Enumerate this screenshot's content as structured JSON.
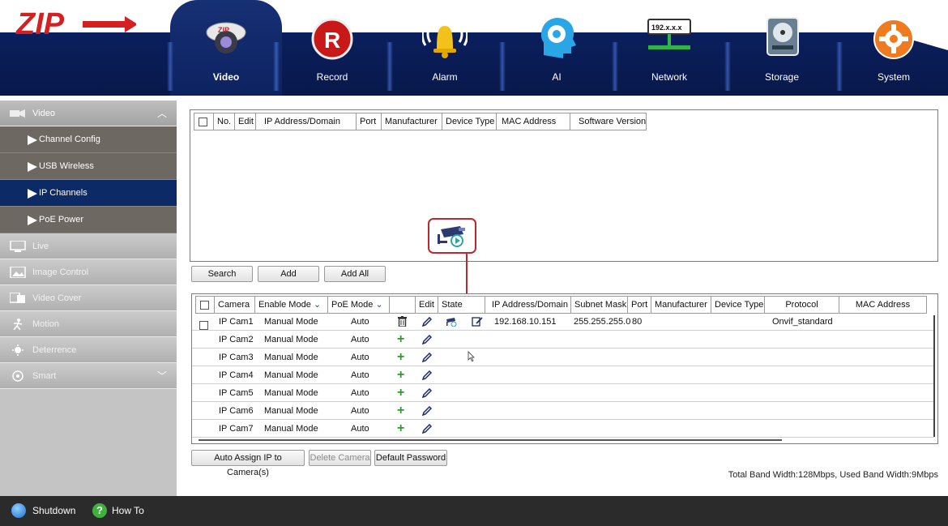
{
  "nav": {
    "items": [
      {
        "label": "Video",
        "icon": "dome-camera-icon",
        "active": true
      },
      {
        "label": "Record",
        "icon": "record-icon"
      },
      {
        "label": "Alarm",
        "icon": "alarm-bell-icon"
      },
      {
        "label": "AI",
        "icon": "ai-head-gear-icon"
      },
      {
        "label": "Network",
        "icon": "network-icon",
        "icon_text": "192.x.x.x"
      },
      {
        "label": "Storage",
        "icon": "hard-disk-icon"
      },
      {
        "label": "System",
        "icon": "system-gear-icon"
      }
    ]
  },
  "logo": {
    "text": "ZIP"
  },
  "sidebar": {
    "video": {
      "label": "Video"
    },
    "subitems": [
      {
        "label": "Channel Config"
      },
      {
        "label": "USB Wireless"
      },
      {
        "label": "IP Channels",
        "active": true
      },
      {
        "label": "PoE Power"
      }
    ],
    "groups": [
      {
        "label": "Live",
        "icon": "monitor-icon"
      },
      {
        "label": "Image Control",
        "icon": "image-icon"
      },
      {
        "label": "Video Cover",
        "icon": "video-cover-icon"
      },
      {
        "label": "Motion",
        "icon": "motion-icon"
      },
      {
        "label": "Deterrence",
        "icon": "deterrence-icon"
      },
      {
        "label": "Smart",
        "icon": "smart-icon"
      }
    ]
  },
  "search_table": {
    "headers": [
      "No.",
      "Edit",
      "IP Address/Domain",
      "Port",
      "Manufacturer",
      "Device Type",
      "MAC Address",
      "Software Version"
    ]
  },
  "search_buttons": {
    "search": "Search",
    "add": "Add",
    "add_all": "Add All"
  },
  "cam_table": {
    "headers": {
      "camera": "Camera",
      "enable_mode": "Enable Mode",
      "poe_mode": "PoE Mode",
      "edit": "Edit",
      "state": "State",
      "ip": "IP Address/Domain",
      "subnet": "Subnet Mask",
      "port": "Port",
      "manufacturer": "Manufacturer",
      "device_type": "Device Type",
      "protocol": "Protocol",
      "mac": "MAC Address"
    },
    "rows": [
      {
        "camera": "IP Cam1",
        "mode": "Manual Mode",
        "poe": "Auto",
        "action": "delete",
        "ip": "192.168.10.151",
        "subnet": "255.255.255.0",
        "port": "80",
        "protocol": "Onvif_standard",
        "connected": true
      },
      {
        "camera": "IP Cam2",
        "mode": "Manual Mode",
        "poe": "Auto",
        "action": "add"
      },
      {
        "camera": "IP Cam3",
        "mode": "Manual Mode",
        "poe": "Auto",
        "action": "add"
      },
      {
        "camera": "IP Cam4",
        "mode": "Manual Mode",
        "poe": "Auto",
        "action": "add"
      },
      {
        "camera": "IP Cam5",
        "mode": "Manual Mode",
        "poe": "Auto",
        "action": "add"
      },
      {
        "camera": "IP Cam6",
        "mode": "Manual Mode",
        "poe": "Auto",
        "action": "add"
      },
      {
        "camera": "IP Cam7",
        "mode": "Manual Mode",
        "poe": "Auto",
        "action": "add"
      }
    ]
  },
  "bottom_buttons": {
    "auto_assign": "Auto Assign IP to Camera(s)",
    "delete_camera": "Delete Camera",
    "default_password": "Default Password"
  },
  "bandwidth": "Total Band Width:128Mbps, Used Band Width:9Mbps",
  "footer": {
    "shutdown": "Shutdown",
    "howto": "How To"
  },
  "colors": {
    "nav_bg": "#0a1f5e",
    "sidebar_active": "#0b2a66",
    "callout": "#c0262d",
    "plus_green": "#2c9a2c"
  }
}
